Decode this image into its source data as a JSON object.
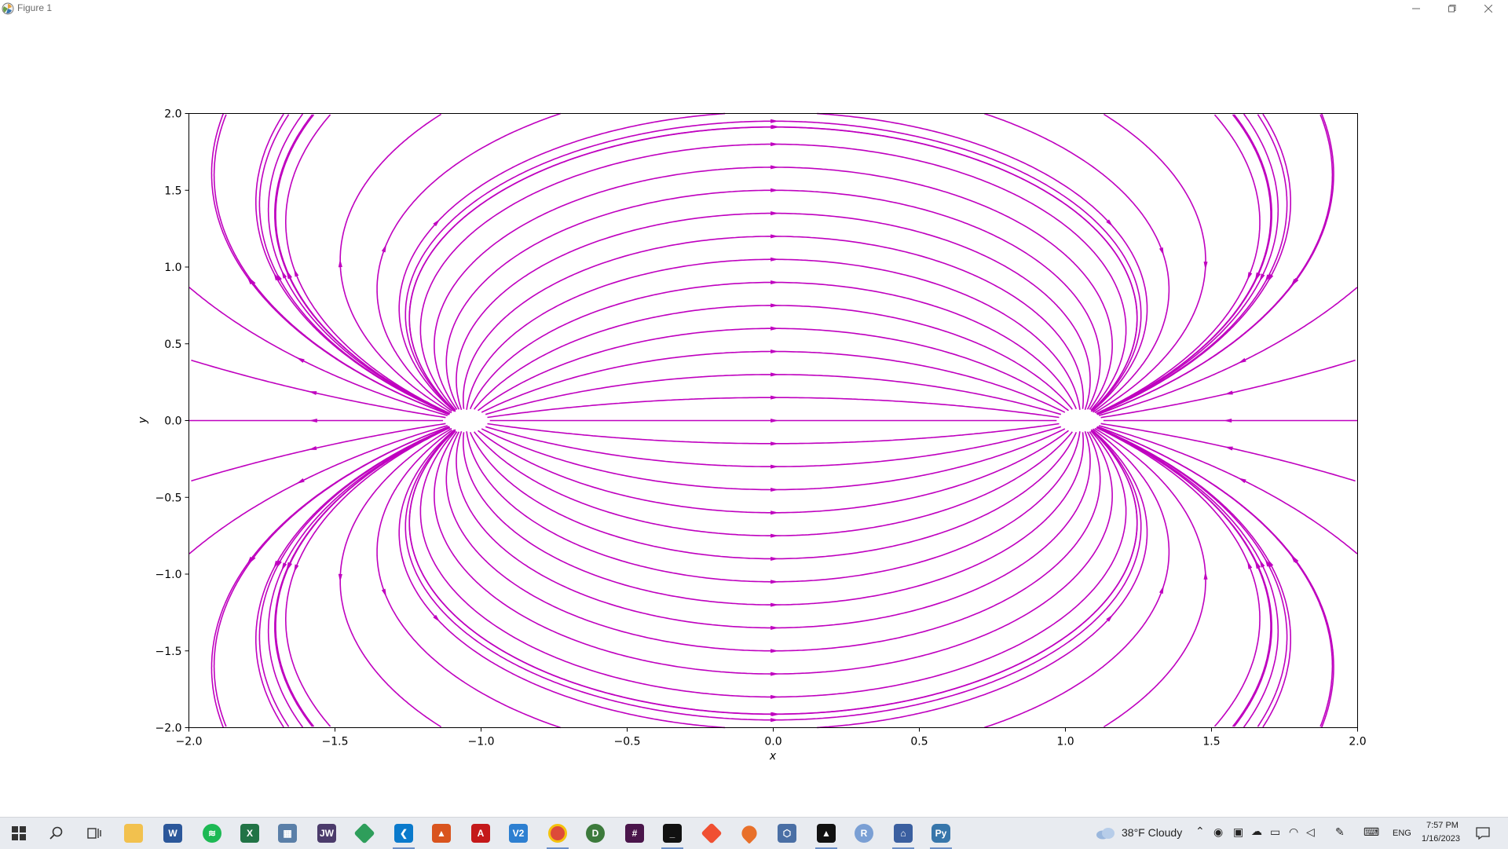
{
  "window": {
    "title": "Figure 1",
    "app_icon": "matplotlib-icon",
    "controls": [
      "minimize-icon",
      "maximize-icon",
      "close-icon"
    ]
  },
  "chart_data": {
    "type": "streamplot",
    "field": "vector field with sources/sinks near (-1, 0) and (1, 0); flow runs left-to-right along the central band and diverges outward near the outer edges",
    "xlabel": "x",
    "ylabel": "y",
    "xlim": [
      -2.0,
      2.0
    ],
    "ylim": [
      -2.0,
      2.0
    ],
    "xticks": [
      "−2.0",
      "−1.5",
      "−1.0",
      "−0.5",
      "0.0",
      "0.5",
      "1.0",
      "1.5",
      "2.0"
    ],
    "yticks": [
      "−2.0",
      "−1.5",
      "−1.0",
      "−0.5",
      "0.0",
      "0.5",
      "1.0",
      "1.5",
      "2.0"
    ],
    "line_color": "#bf00bf",
    "grid": false
  },
  "taskbar": {
    "weather": "38°F  Cloudy",
    "language": "ENG",
    "time": "7:57 PM",
    "date": "1/16/2023",
    "apps": [
      "start-icon",
      "search-icon",
      "task-view-icon",
      "file-explorer-icon",
      "word-icon",
      "spotify-icon",
      "excel-icon",
      "calculator-icon",
      "jw-icon",
      "app-diamond-icon",
      "vscode-icon",
      "matlab-icon",
      "acrobat-icon",
      "v2-icon",
      "chrome-icon",
      "chrome-dev-icon",
      "slack-icon",
      "terminal-icon",
      "git-icon",
      "blender-drop-icon",
      "3d-box-icon",
      "inkscape-icon",
      "r-icon",
      "network-app-icon",
      "python-icon"
    ]
  }
}
